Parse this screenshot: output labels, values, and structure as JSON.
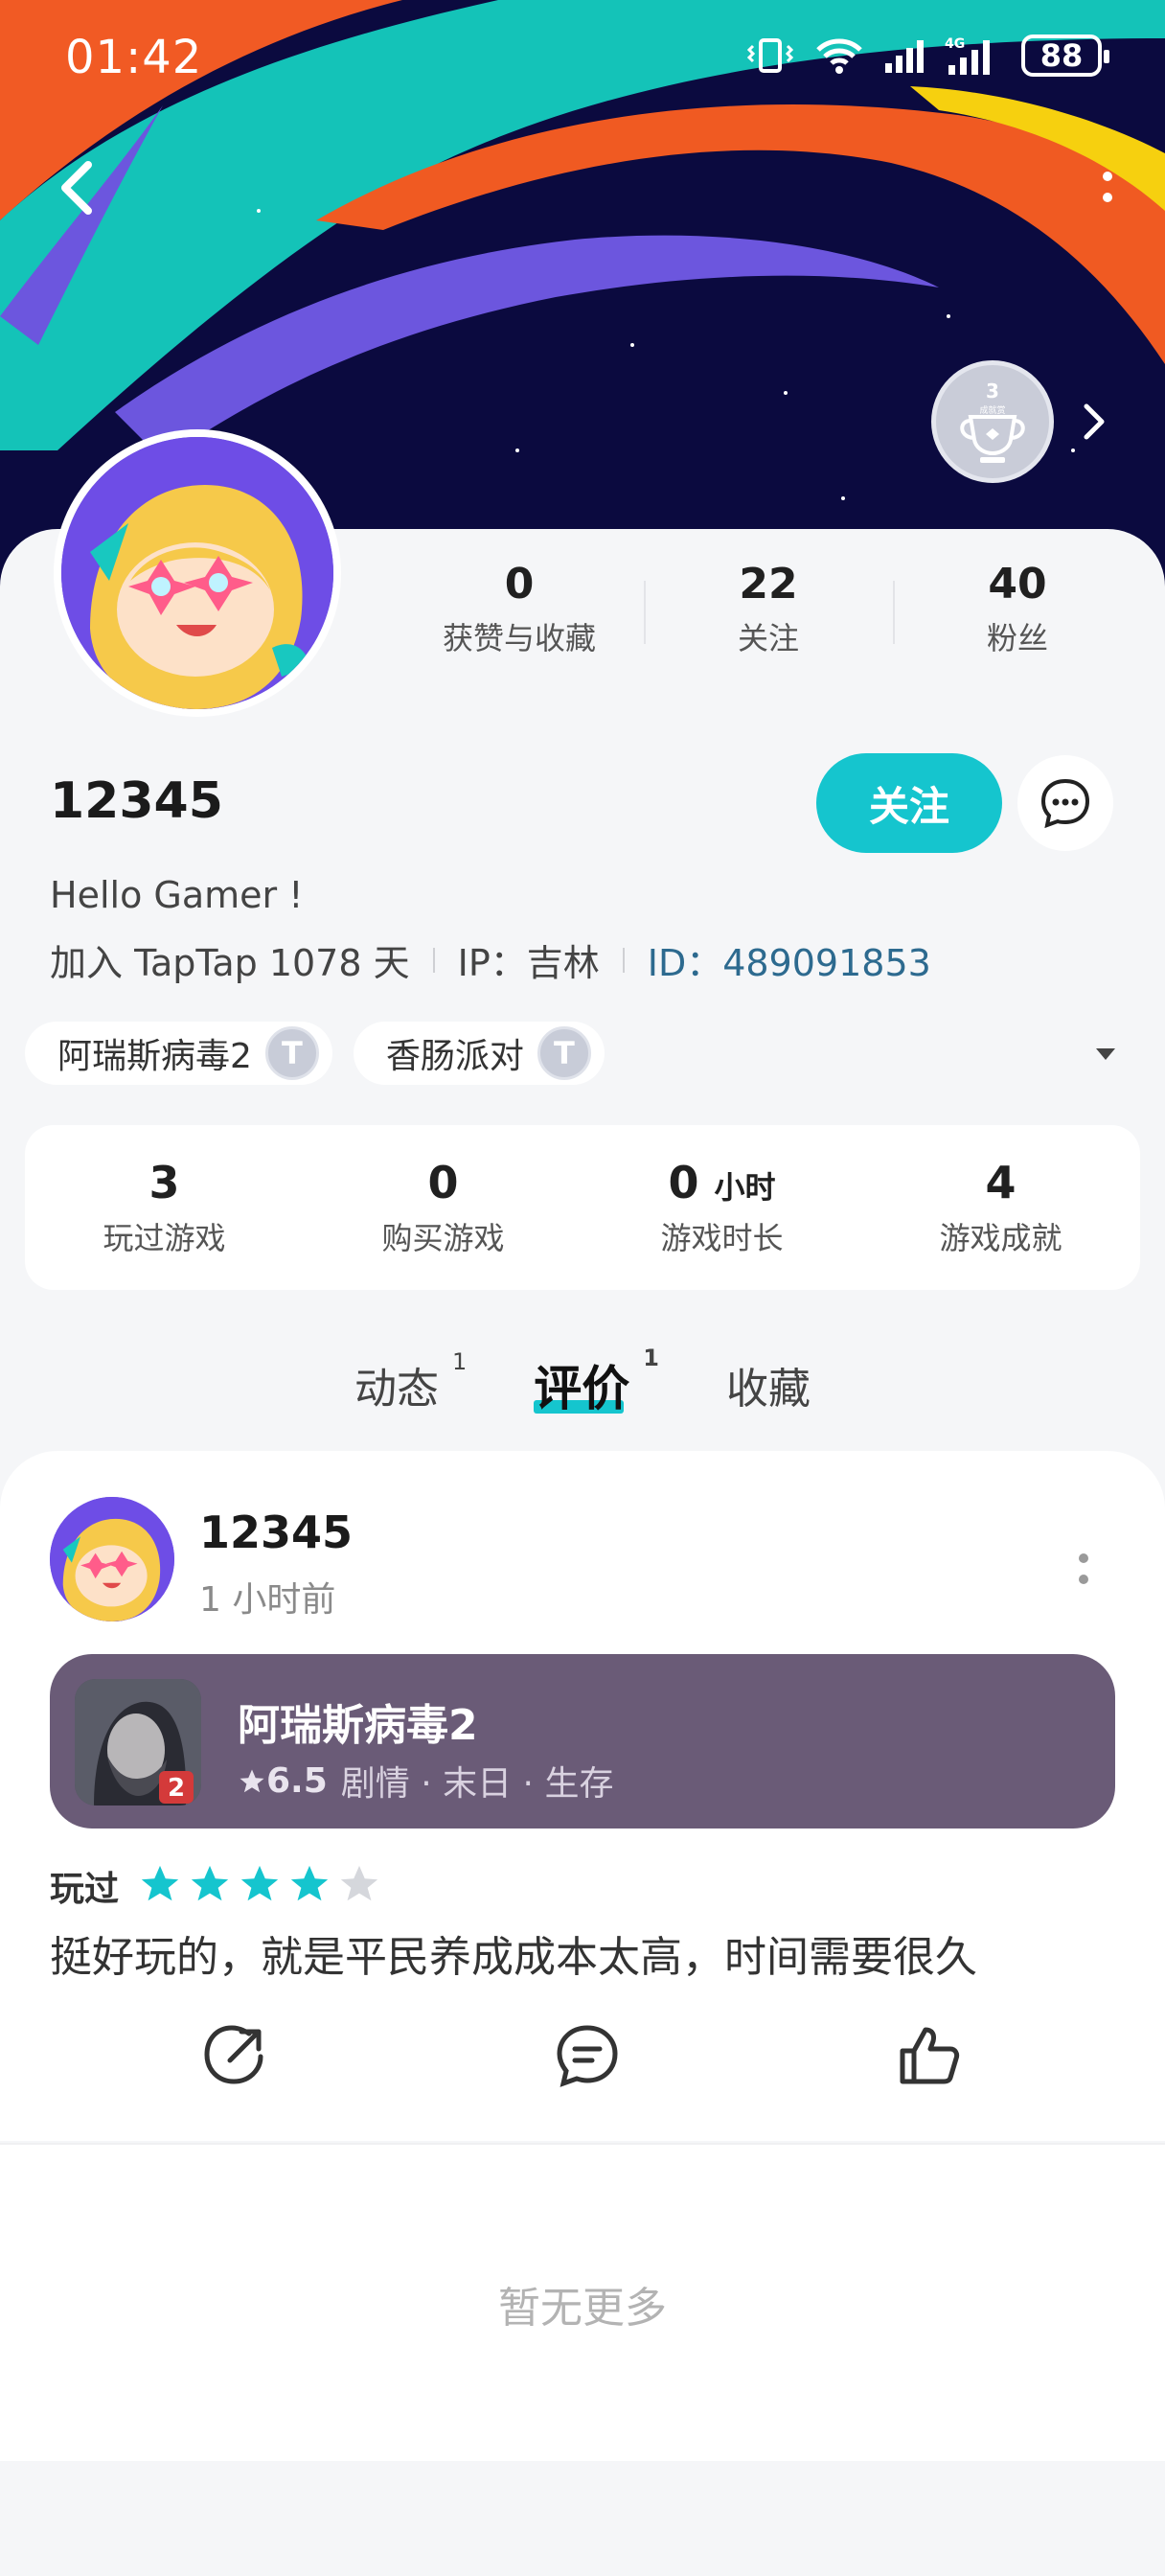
{
  "status_bar": {
    "time": "01:42",
    "battery": "88",
    "icons": [
      "vibrate-icon",
      "wifi-icon",
      "signal-icon",
      "4g-signal-icon"
    ]
  },
  "header": {
    "back_icon": "chevron-left-icon",
    "more_icon": "more-vertical-icon",
    "achievement_badge": {
      "count": "3",
      "label": "成就赏"
    }
  },
  "profile": {
    "stats": [
      {
        "value": "0",
        "label": "获赞与收藏"
      },
      {
        "value": "22",
        "label": "关注"
      },
      {
        "value": "40",
        "label": "粉丝"
      }
    ],
    "username": "12345",
    "follow_label": "关注",
    "bio": "Hello Gamer !",
    "joined": "加入 TapTap 1078 天",
    "ip": "IP：吉林",
    "id": "ID：489091853",
    "tags": [
      {
        "label": "阿瑞斯病毒2",
        "badge": "T"
      },
      {
        "label": "香肠派对",
        "badge": "T"
      }
    ]
  },
  "game_stats": [
    {
      "value": "3",
      "unit": "",
      "label": "玩过游戏"
    },
    {
      "value": "0",
      "unit": "",
      "label": "购买游戏"
    },
    {
      "value": "0",
      "unit": "小时",
      "label": "游戏时长"
    },
    {
      "value": "4",
      "unit": "",
      "label": "游戏成就"
    }
  ],
  "tabs": [
    {
      "label": "动态",
      "count": "1"
    },
    {
      "label": "评价",
      "count": "1",
      "active": true
    },
    {
      "label": "收藏",
      "count": ""
    }
  ],
  "review": {
    "author": "12345",
    "time": "1 小时前",
    "game": {
      "title": "阿瑞斯病毒2",
      "score": "6.5",
      "genres": "剧情 · 末日 · 生存",
      "icon_badge": "2"
    },
    "played_label": "玩过",
    "rating": 4,
    "rating_max": 5,
    "text": "挺好玩的，就是平民养成成本太高，时间需要很久"
  },
  "footer": {
    "no_more": "暂无更多"
  },
  "colors": {
    "accent": "#15c5ce",
    "banner_bg": "#0b0a3f",
    "game_card": "#6a5b77",
    "id_link": "#2d6a8f"
  }
}
